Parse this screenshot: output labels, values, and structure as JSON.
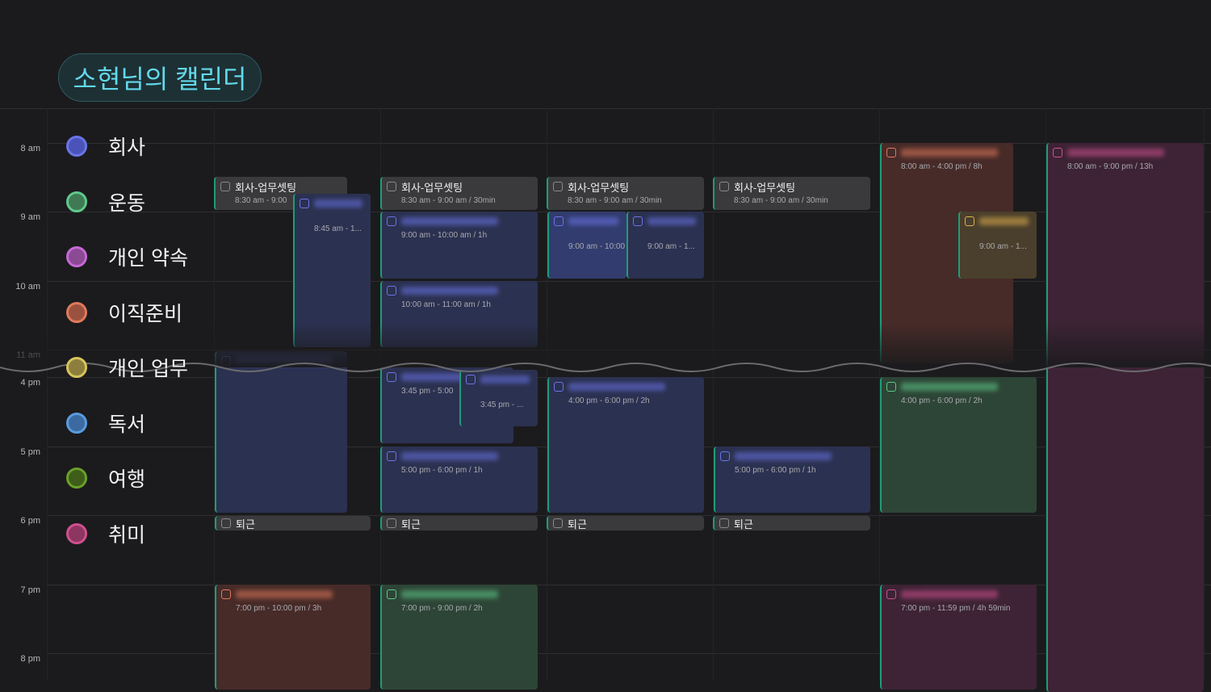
{
  "title": "소현님의 캘린더",
  "colors": {
    "accent": "#63d8ea",
    "work": "#6a74e8",
    "exercise": "#5fc98a",
    "appointment": "#c768d6",
    "job": "#e07a5c",
    "personal": "#d6c45c",
    "reading": "#5a9ae0",
    "travel": "#6aa02a",
    "hobby": "#d0508e"
  },
  "legend": [
    {
      "label": "회사",
      "color": "#6a74e8",
      "fill": "#4a54b8"
    },
    {
      "label": "운동",
      "color": "#5fc98a",
      "fill": "#3f7a55"
    },
    {
      "label": "개인 약속",
      "color": "#c768d6",
      "fill": "#8a4a94"
    },
    {
      "label": "이직준비",
      "color": "#e07a5c",
      "fill": "#9a523e"
    },
    {
      "label": "개인 업무",
      "color": "#d6c45c",
      "fill": "#8c7e3c"
    },
    {
      "label": "독서",
      "color": "#5a9ae0",
      "fill": "#3c6aa0"
    },
    {
      "label": "여행",
      "color": "#6aa02a",
      "fill": "#3e5e1a"
    },
    {
      "label": "취미",
      "color": "#d0508e",
      "fill": "#8c3660"
    }
  ],
  "time_labels": [
    "8 am",
    "9 am",
    "10 am",
    "11 am",
    "4 pm",
    "5 pm",
    "6 pm",
    "7 pm",
    "8 pm"
  ],
  "events": [
    {
      "title": "회사-업무셋팅",
      "time": "8:30 am - 9:00",
      "style": "gray"
    },
    {
      "title": "",
      "time": "8:45 am - 1...",
      "style": "blue"
    },
    {
      "title": "",
      "time": "",
      "style": "blue"
    },
    {
      "title": "퇴근",
      "time": "",
      "style": "gray"
    },
    {
      "title": "",
      "time": "7:00 pm - 10:00 pm / 3h",
      "style": "brown"
    },
    {
      "title": "회사-업무셋팅",
      "time": "8:30 am - 9:00 am / 30min",
      "style": "gray"
    },
    {
      "title": "",
      "time": "9:00 am - 10:00 am / 1h",
      "style": "blue"
    },
    {
      "title": "",
      "time": "10:00 am - 11:00 am / 1h",
      "style": "blue"
    },
    {
      "title": "",
      "time": "3:45 pm - 5:00",
      "style": "blue"
    },
    {
      "title": "",
      "time": "3:45 pm - ...",
      "style": "blue"
    },
    {
      "title": "",
      "time": "5:00 pm - 6:00 pm / 1h",
      "style": "blue"
    },
    {
      "title": "퇴근",
      "time": "",
      "style": "gray"
    },
    {
      "title": "",
      "time": "7:00 pm - 9:00 pm / 2h",
      "style": "green"
    },
    {
      "title": "회사-업무셋팅",
      "time": "8:30 am - 9:00 am / 30min",
      "style": "gray"
    },
    {
      "title": "",
      "time": "9:00 am - 10:00 am",
      "style": "blue2"
    },
    {
      "title": "",
      "time": "9:00 am - 1...",
      "style": "blue"
    },
    {
      "title": "",
      "time": "4:00 pm - 6:00 pm / 2h",
      "style": "blue"
    },
    {
      "title": "퇴근",
      "time": "",
      "style": "gray"
    },
    {
      "title": "회사-업무셋팅",
      "time": "8:30 am - 9:00 am / 30min",
      "style": "gray"
    },
    {
      "title": "",
      "time": "5:00 pm - 6:00 pm / 1h",
      "style": "blue"
    },
    {
      "title": "퇴근",
      "time": "",
      "style": "gray"
    },
    {
      "title": "",
      "time": "8:00 am - 4:00 pm / 8h",
      "style": "brown"
    },
    {
      "title": "",
      "time": "9:00 am - 1...",
      "style": "olive"
    },
    {
      "title": "",
      "time": "4:00 pm - 6:00 pm / 2h",
      "style": "green"
    },
    {
      "title": "",
      "time": "7:00 pm - 11:59 pm / 4h 59min",
      "style": "purple"
    },
    {
      "title": "",
      "time": "8:00 am - 9:00 pm / 13h",
      "style": "purple"
    }
  ]
}
